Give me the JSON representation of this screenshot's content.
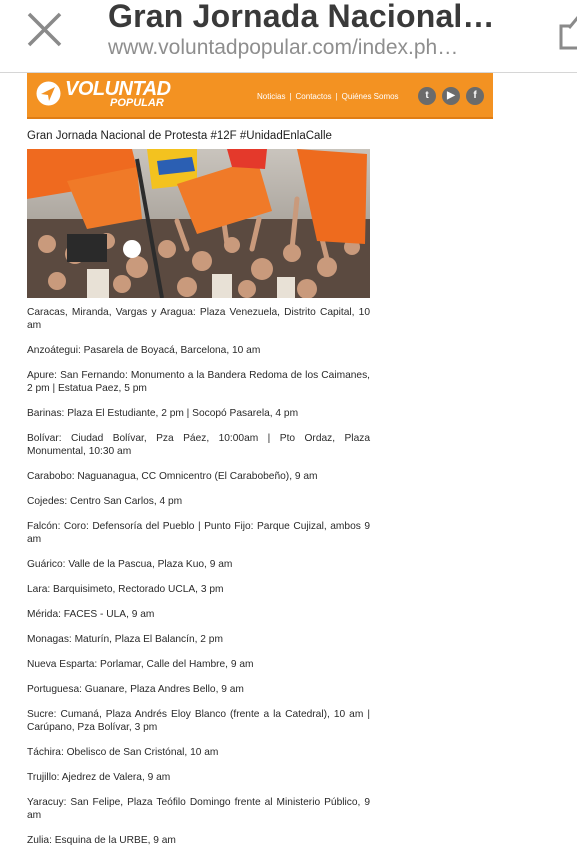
{
  "browser": {
    "title": "Gran Jornada Nacional…",
    "url": "www.voluntadpopular.com/index.ph…"
  },
  "site": {
    "logo_main": "VOLUNTAD",
    "logo_sub": "POPULAR",
    "nav": [
      "Noticias",
      "Contactos",
      "Quiénes Somos"
    ],
    "social": [
      "twitter-icon",
      "youtube-icon",
      "facebook-icon"
    ],
    "accent_color": "#f39222"
  },
  "article": {
    "title": "Gran Jornada Nacional de Protesta #12F #UnidadEnlaCalle",
    "items": [
      "Caracas, Miranda, Vargas y Aragua: Plaza Venezuela, Distrito Capital, 10 am",
      "Anzoátegui: Pasarela de Boyacá, Barcelona, 10 am",
      "Apure: San Fernando: Monumento a la Bandera Redoma de los Caimanes, 2 pm | Estatua Paez, 5 pm",
      "Barinas: Plaza El Estudiante, 2 pm | Socopó Pasarela, 4 pm",
      "Bolívar: Ciudad Bolívar, Pza Páez, 10:00am | Pto Ordaz, Plaza Monumental, 10:30 am",
      "Carabobo: Naguanagua, CC Omnicentro (El Carabobeño), 9 am",
      "Cojedes: Centro San Carlos, 4 pm",
      "Falcón: Coro: Defensoría del Pueblo | Punto Fijo: Parque Cujizal, ambos 9 am",
      "Guárico: Valle de la Pascua, Plaza Kuo, 9 am",
      "Lara: Barquisimeto, Rectorado UCLA, 3 pm",
      "Mérida: FACES - ULA, 9 am",
      "Monagas: Maturín, Plaza El Balancín, 2 pm",
      "Nueva Esparta: Porlamar, Calle del Hambre, 9 am",
      "Portuguesa: Guanare, Plaza Andres Bello, 9 am",
      "Sucre: Cumaná, Plaza Andrés Eloy Blanco (frente a la Catedral), 10 am | Carúpano, Pza Bolívar, 3 pm",
      "Táchira: Obelisco de San Cristónal, 10 am",
      "Trujillo: Ajedrez de Valera, 9 am",
      "Yaracuy: San Felipe, Plaza Teófilo Domingo frente al Ministerio Público, 9 am",
      "Zulia: Esquina de la URBE, 9 am"
    ]
  }
}
